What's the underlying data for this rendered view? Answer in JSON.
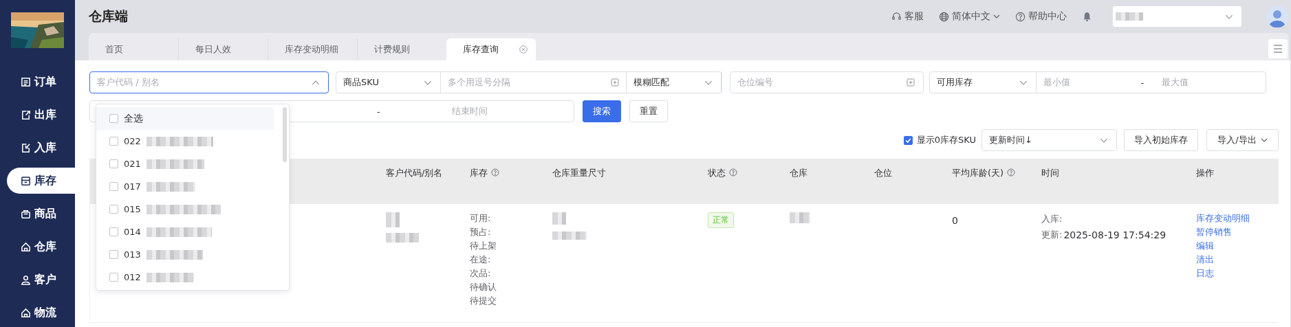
{
  "app": {
    "title": "仓库端"
  },
  "header_links": [
    {
      "kind": "headset",
      "label": "客服",
      "caret": false
    },
    {
      "kind": "globe",
      "label": "简体中文",
      "caret": true
    },
    {
      "kind": "help",
      "label": "帮助中心",
      "caret": false
    }
  ],
  "sidebar": {
    "items": [
      {
        "label": "订单",
        "selected": false
      },
      {
        "label": "出库",
        "selected": false
      },
      {
        "label": "入库",
        "selected": false
      },
      {
        "label": "库存",
        "selected": true
      },
      {
        "label": "商品",
        "selected": false
      },
      {
        "label": "仓库",
        "selected": false
      },
      {
        "label": "客户",
        "selected": false
      },
      {
        "label": "物流",
        "selected": false
      }
    ]
  },
  "tabs": [
    {
      "label": "首页",
      "selected": false,
      "closable": false
    },
    {
      "label": "每日人效",
      "selected": false,
      "closable": false
    },
    {
      "label": "库存变动明细",
      "selected": false,
      "closable": false
    },
    {
      "label": "计费规则",
      "selected": false,
      "closable": false
    },
    {
      "label": "库存查询",
      "selected": true,
      "closable": true
    }
  ],
  "filters": {
    "customer": {
      "placeholder": "客户代码 / 别名",
      "open": true
    },
    "sku_type": "商品SKU",
    "sku": {
      "placeholder": "多个用逗号分隔"
    },
    "match": "模糊匹配",
    "location": {
      "placeholder": "仓位编号"
    },
    "stock_type": "可用库存",
    "stock_min": {
      "placeholder": "最小值"
    },
    "stock_sep": "-",
    "stock_max": {
      "placeholder": "最大值"
    },
    "date_sep": "-",
    "date_end": {
      "placeholder": "结束时间"
    },
    "search_button": "搜索",
    "reset_button": "重置"
  },
  "customer_options": [
    {
      "label": "全选",
      "checked": false,
      "highlighted": true
    },
    {
      "label": "022",
      "checked": false,
      "highlighted": false
    },
    {
      "label": "021",
      "checked": false,
      "highlighted": false
    },
    {
      "label": "017",
      "checked": false,
      "highlighted": false
    },
    {
      "label": "015",
      "checked": false,
      "highlighted": false
    },
    {
      "label": "014",
      "checked": false,
      "highlighted": false
    },
    {
      "label": "013",
      "checked": false,
      "highlighted": false
    },
    {
      "label": "012",
      "checked": false,
      "highlighted": false
    }
  ],
  "toolbar": {
    "show_zero": {
      "label": "显示0库存SKU",
      "checked": true
    },
    "sort": "更新时间↓",
    "import_button": "导入初始库存",
    "export_button": "导入/导出"
  },
  "table": {
    "columns": [
      {
        "label": "客户代码/别名",
        "help": false
      },
      {
        "label": "库存",
        "help": true
      },
      {
        "label": "仓库重量尺寸",
        "help": false
      },
      {
        "label": "状态",
        "help": true
      },
      {
        "label": "仓库",
        "help": false
      },
      {
        "label": "仓位",
        "help": false
      },
      {
        "label": "平均库龄(天)",
        "help": true
      },
      {
        "label": "时间",
        "help": false
      },
      {
        "label": "操作",
        "help": false
      }
    ],
    "rows": [
      {
        "stock_lines": [
          "可用:",
          "预占:",
          "待上架",
          "在途:",
          "次品:",
          "待确认",
          "待提交"
        ],
        "status": {
          "label": "正常",
          "kind": "normal"
        },
        "avg_age": "0",
        "times": [
          {
            "label": "入库:"
          },
          {
            "label": "更新:",
            "value": "2025-08-19 17:54:29"
          }
        ],
        "actions": [
          "库存变动明细",
          "暂停销售",
          "编辑",
          "清出",
          "日志"
        ]
      }
    ]
  }
}
